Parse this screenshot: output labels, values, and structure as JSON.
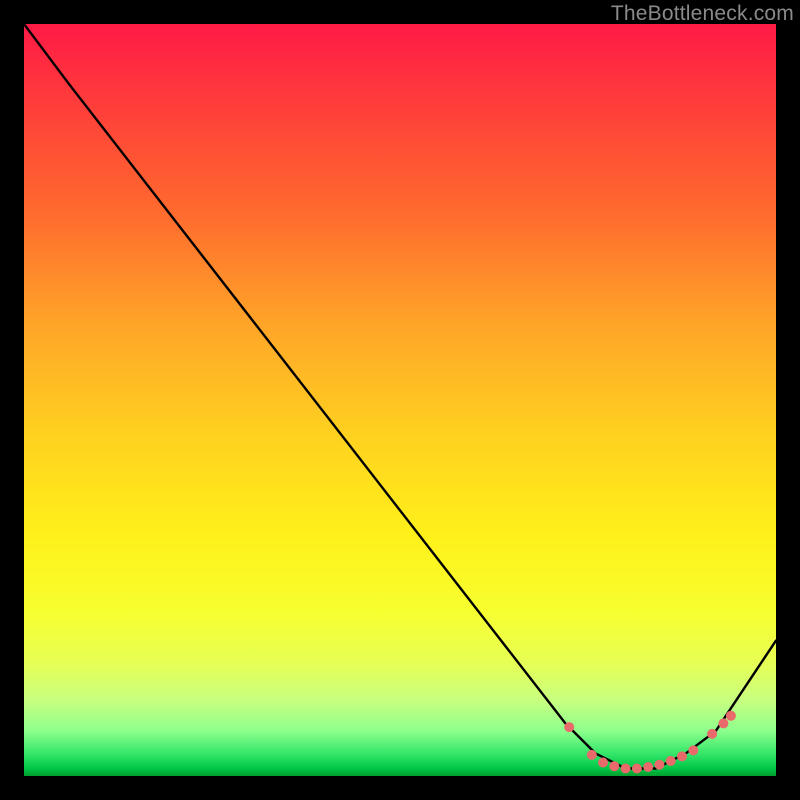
{
  "watermark": "TheBottleneck.com",
  "chart_data": {
    "type": "line",
    "title": "",
    "xlabel": "",
    "ylabel": "",
    "xlim": [
      0,
      100
    ],
    "ylim": [
      0,
      100
    ],
    "background_gradient": {
      "top": "#ff1a46",
      "bottom": "#009e2e"
    },
    "series": [
      {
        "name": "curve",
        "stroke": "#000000",
        "x": [
          0,
          6,
          72,
          76,
          80,
          84,
          88,
          92,
          100
        ],
        "y": [
          100,
          92,
          7,
          3,
          1,
          1,
          3,
          6,
          18
        ]
      }
    ],
    "markers": {
      "name": "dots",
      "color": "#e86a6a",
      "radius": 5,
      "x": [
        72.5,
        75.5,
        77,
        78.5,
        80,
        81.5,
        83,
        84.5,
        86,
        87.5,
        89,
        91.5,
        93,
        94
      ],
      "y": [
        6.5,
        2.8,
        1.8,
        1.3,
        1.0,
        1.0,
        1.2,
        1.5,
        2.0,
        2.6,
        3.4,
        5.6,
        7.0,
        8.0
      ]
    }
  }
}
